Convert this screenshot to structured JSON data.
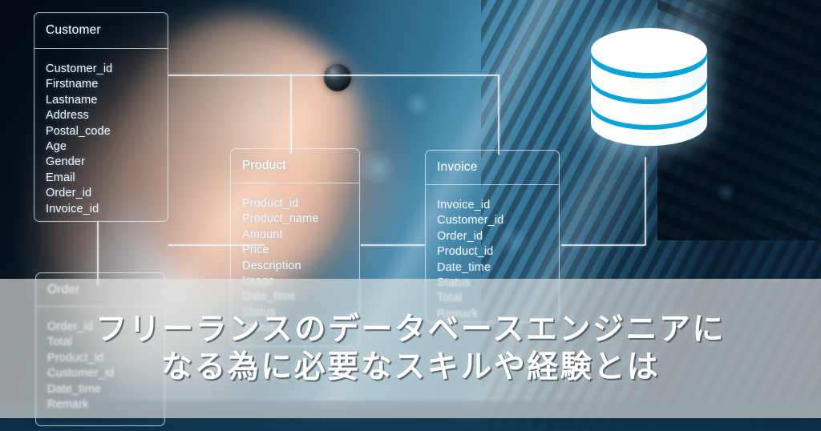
{
  "hero": {
    "title_lines": [
      "フリーランスのデータベースエンジニアに",
      "なる為に必要なスキルや経験とは"
    ],
    "band_color": "#e2e4e0",
    "title_color": "#ffffff"
  },
  "icons": {
    "database_cylinder": {
      "name": "database-cylinder-icon",
      "body_color": "#ffffff",
      "band_color": "#0aa3dc",
      "band_count": 3
    }
  },
  "diagram": {
    "type": "entity-relationship-diagram",
    "line_color": "#ecf4fa",
    "text_color": "#f2f7fb",
    "tables": [
      {
        "name": "Customer",
        "fields": [
          "Customer_id",
          "Firstname",
          "Lastname",
          "Address",
          "Postal_code",
          "Age",
          "Gender",
          "Email",
          "Order_id",
          "Invoice_id"
        ]
      },
      {
        "name": "Product",
        "fields": [
          "Product_id",
          "Product_name",
          "Amount",
          "Price",
          "Description",
          "Image",
          "Date_time",
          "Status",
          "Status"
        ]
      },
      {
        "name": "Invoice",
        "fields": [
          "Invoice_id",
          "Customer_id",
          "Order_id",
          "Product_id",
          "Date_time",
          "Status",
          "Total",
          "Remark"
        ]
      },
      {
        "name": "Order",
        "fields": [
          "Order_id",
          "Total",
          "Product_id",
          "Customer_id",
          "Date_time",
          "Remark"
        ]
      }
    ]
  }
}
